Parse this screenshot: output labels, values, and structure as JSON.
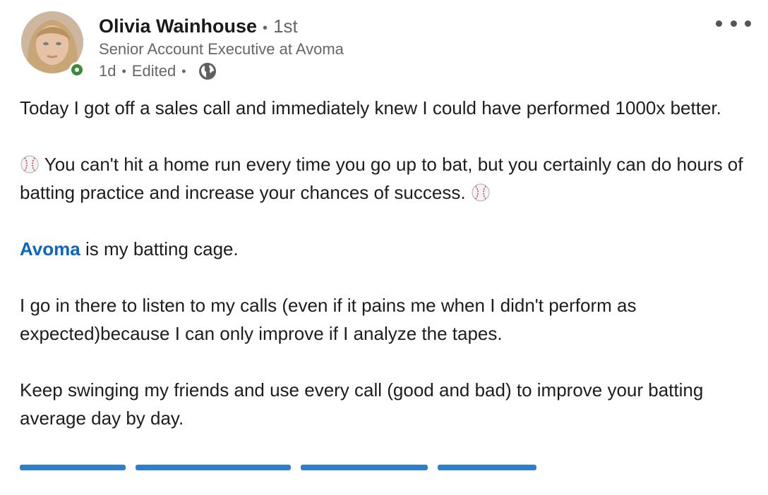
{
  "author": {
    "name": "Olivia Wainhouse",
    "separator": "•",
    "degree": "1st",
    "headline": "Senior Account Executive at Avoma",
    "time": "1d",
    "edited": "Edited",
    "dot": "•",
    "visibility_icon": "globe-icon",
    "status": "online"
  },
  "menu": {
    "icon": "more-horizontal-icon"
  },
  "post": {
    "line1": "Today I got off a sales call and immediately knew I could have performed 1000x better.",
    "line2": "You can't hit a home run every time you go up to bat, but you certainly can do hours of batting practice and increase your chances of success.",
    "emoji_icon": "baseball-icon",
    "mention": "Avoma",
    "line3_rest": " is my batting cage.",
    "line4": "I go in there to listen to my calls (even if it pains me when I didn't perform as expected)because I can only improve if I analyze the tapes.",
    "line5": "Keep swinging my friends and use every call (good and bad) to improve your batting average day by day."
  },
  "colors": {
    "link": "#0a66c2",
    "muted": "#666666",
    "status_green": "#3a8a3a"
  }
}
